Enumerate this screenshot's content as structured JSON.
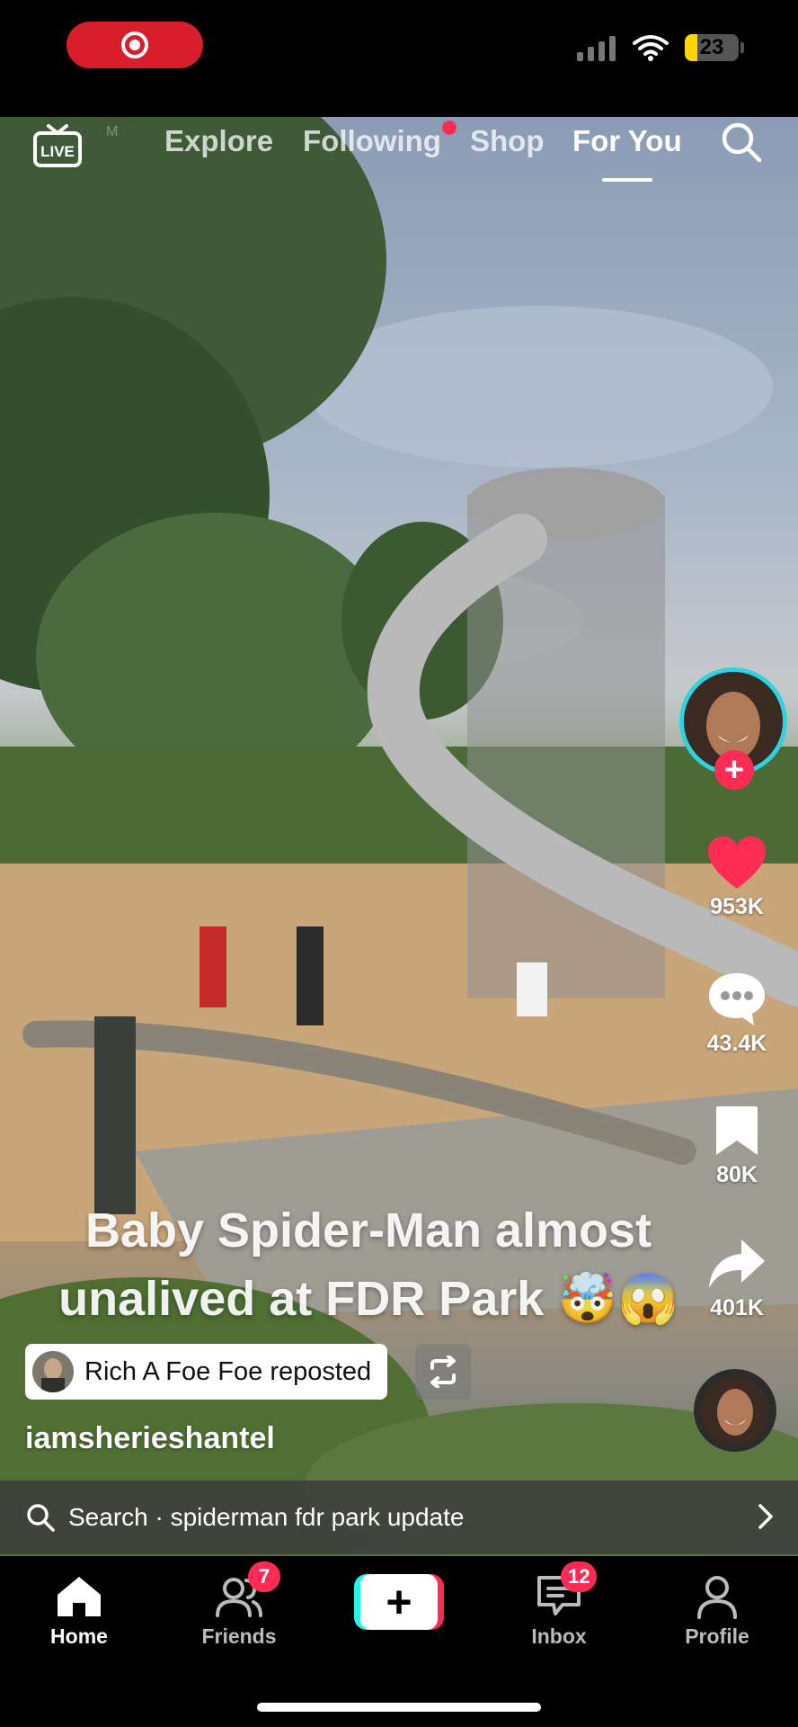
{
  "status_bar": {
    "battery": "23",
    "icons": [
      "record-icon",
      "cellular-signal-icon",
      "wifi-icon",
      "battery-icon"
    ]
  },
  "top_nav": {
    "live_label": "LIVE",
    "tabs": [
      {
        "label": "M"
      },
      {
        "label": "Explore"
      },
      {
        "label": "Following"
      },
      {
        "label": "Shop"
      },
      {
        "label": "For You"
      }
    ],
    "active_tab": "For You"
  },
  "video": {
    "caption": "Baby Spider-Man almost unalived at FDR Park 🤯😱",
    "repost_text": "Rich A Foe Foe reposted",
    "username": "iamsherieshantel"
  },
  "actions": {
    "likes": "953K",
    "comments": "43.4K",
    "saves": "80K",
    "shares": "401K"
  },
  "search_suggestion": {
    "text": "Search · spiderman fdr park update"
  },
  "bottom_nav": {
    "home": "Home",
    "friends": "Friends",
    "friends_badge": "7",
    "create": "+",
    "inbox": "Inbox",
    "inbox_badge": "12",
    "profile": "Profile"
  },
  "colors": {
    "accent_red": "#fe2c55",
    "accent_cyan": "#25f4ee",
    "record_red": "#d81e2b",
    "battery_yellow": "#ffd400"
  }
}
